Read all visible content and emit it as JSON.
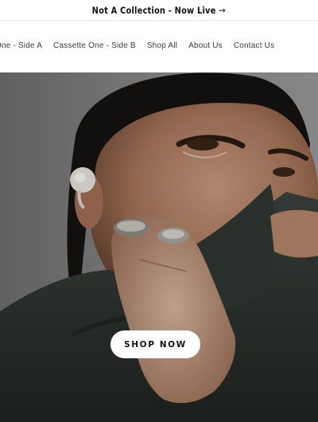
{
  "announcement": {
    "text": "Not A Collection - Now Live",
    "arrow": "→"
  },
  "nav": {
    "items": [
      {
        "label": "One - Side A"
      },
      {
        "label": "Cassette One - Side B"
      },
      {
        "label": "Shop All"
      },
      {
        "label": "About Us"
      },
      {
        "label": "Contact Us"
      }
    ]
  },
  "hero": {
    "cta_label": "SHOP NOW"
  },
  "colors": {
    "background": "#ffffff",
    "hero_gray": "#7a7a7a",
    "garment": "#2c332f",
    "text": "#111111"
  }
}
